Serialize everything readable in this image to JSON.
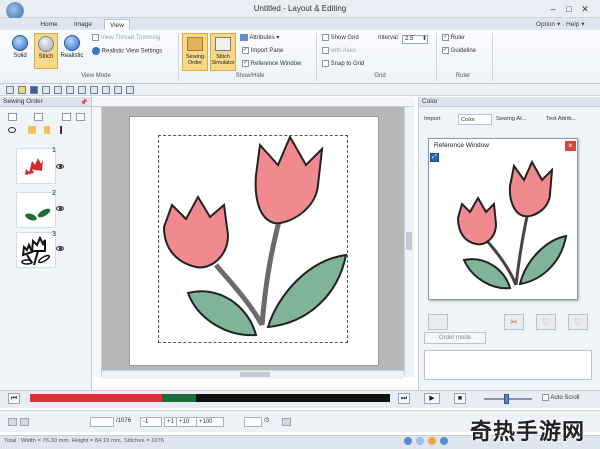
{
  "window": {
    "title": "Untitled - Layout & Editing",
    "controls": [
      "–",
      "□",
      "✕"
    ]
  },
  "ribbon_tabs": {
    "tabs": [
      "Home",
      "Image",
      "View"
    ],
    "active": "View",
    "option": "Option",
    "help": "Help"
  },
  "view_mode": {
    "group_label": "View Mode",
    "buttons": [
      "Solid",
      "Stitch",
      "Realistic"
    ],
    "active": "Stitch",
    "view_thread_trimming": "View Thread Trimming",
    "realistic_view_settings": "Realistic View Settings"
  },
  "show_hide": {
    "group_label": "Show/Hide",
    "sewing_order": "Sewing Order",
    "stitch_simulator": "Stitch Simulator",
    "attributes": "Attributes",
    "import_pane": "Import Pane",
    "reference_window": "Reference Window"
  },
  "grid": {
    "group_label": "Grid",
    "show_grid": "Show Grid",
    "with_axes": "with Axes",
    "snap_to_grid": "Snap to Grid",
    "interval_label": "Interval:",
    "interval_value": "2.5"
  },
  "ruler": {
    "group_label": "Ruler",
    "ruler": "Ruler",
    "guideline": "Guideline"
  },
  "sewing_order_panel": {
    "title": "Sewing Order",
    "items": [
      {
        "num": "1",
        "color": "#d7262c"
      },
      {
        "num": "2",
        "color": "#1e6b3a"
      },
      {
        "num": "3",
        "color": "#111111"
      }
    ]
  },
  "color_panel": {
    "title": "Color",
    "tabs": [
      "Import",
      "Color",
      "Sewing At...",
      "Text Attrib..."
    ],
    "active_tab": "Color",
    "order_button": "Order mode"
  },
  "reference_window": {
    "title": "Reference Window"
  },
  "simulator": {
    "autoscroll": "Auto Scroll"
  },
  "stitch_bar": {
    "total": "/1076",
    "minus1": "-1",
    "plus1": "+1",
    "plus10": "+10",
    "plus100": "+100",
    "color_total": "/3"
  },
  "status": {
    "text": "Total : Width = 76.30 mm, Height = 84.10 mm, Stitches = 1076"
  },
  "watermark": {
    "text": "奇热手游网"
  },
  "colors": {
    "red_thread": "#d7262c",
    "green_thread": "#1e6b3a",
    "black_thread": "#111111",
    "accent_orange": "#f7d98a"
  }
}
